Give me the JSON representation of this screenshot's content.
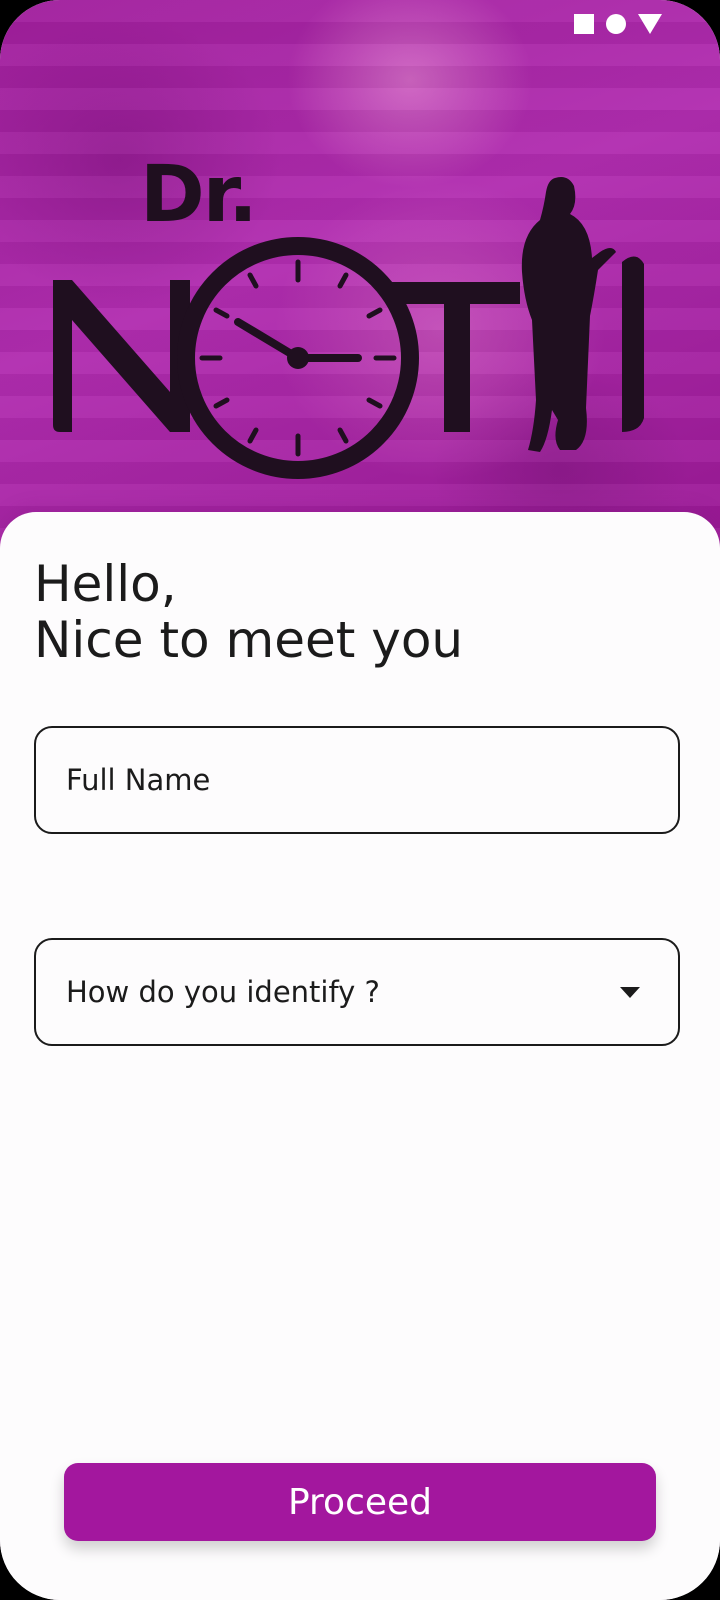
{
  "status_bar": {
    "icons": [
      "square-icon",
      "circle-icon",
      "triangle-icon"
    ]
  },
  "logo": {
    "prefix": "Dr.",
    "wordmark": "NOTii"
  },
  "greeting": {
    "line1": "Hello,",
    "line2": "Nice to meet you"
  },
  "form": {
    "full_name": {
      "placeholder": "Full Name",
      "value": ""
    },
    "identity": {
      "label": "How do you identify ?",
      "icon": "chevron-down-icon"
    }
  },
  "actions": {
    "proceed_label": "Proceed"
  },
  "colors": {
    "brand": "#a3179e",
    "text": "#1b1b1b",
    "background": "#fdfcfd"
  }
}
